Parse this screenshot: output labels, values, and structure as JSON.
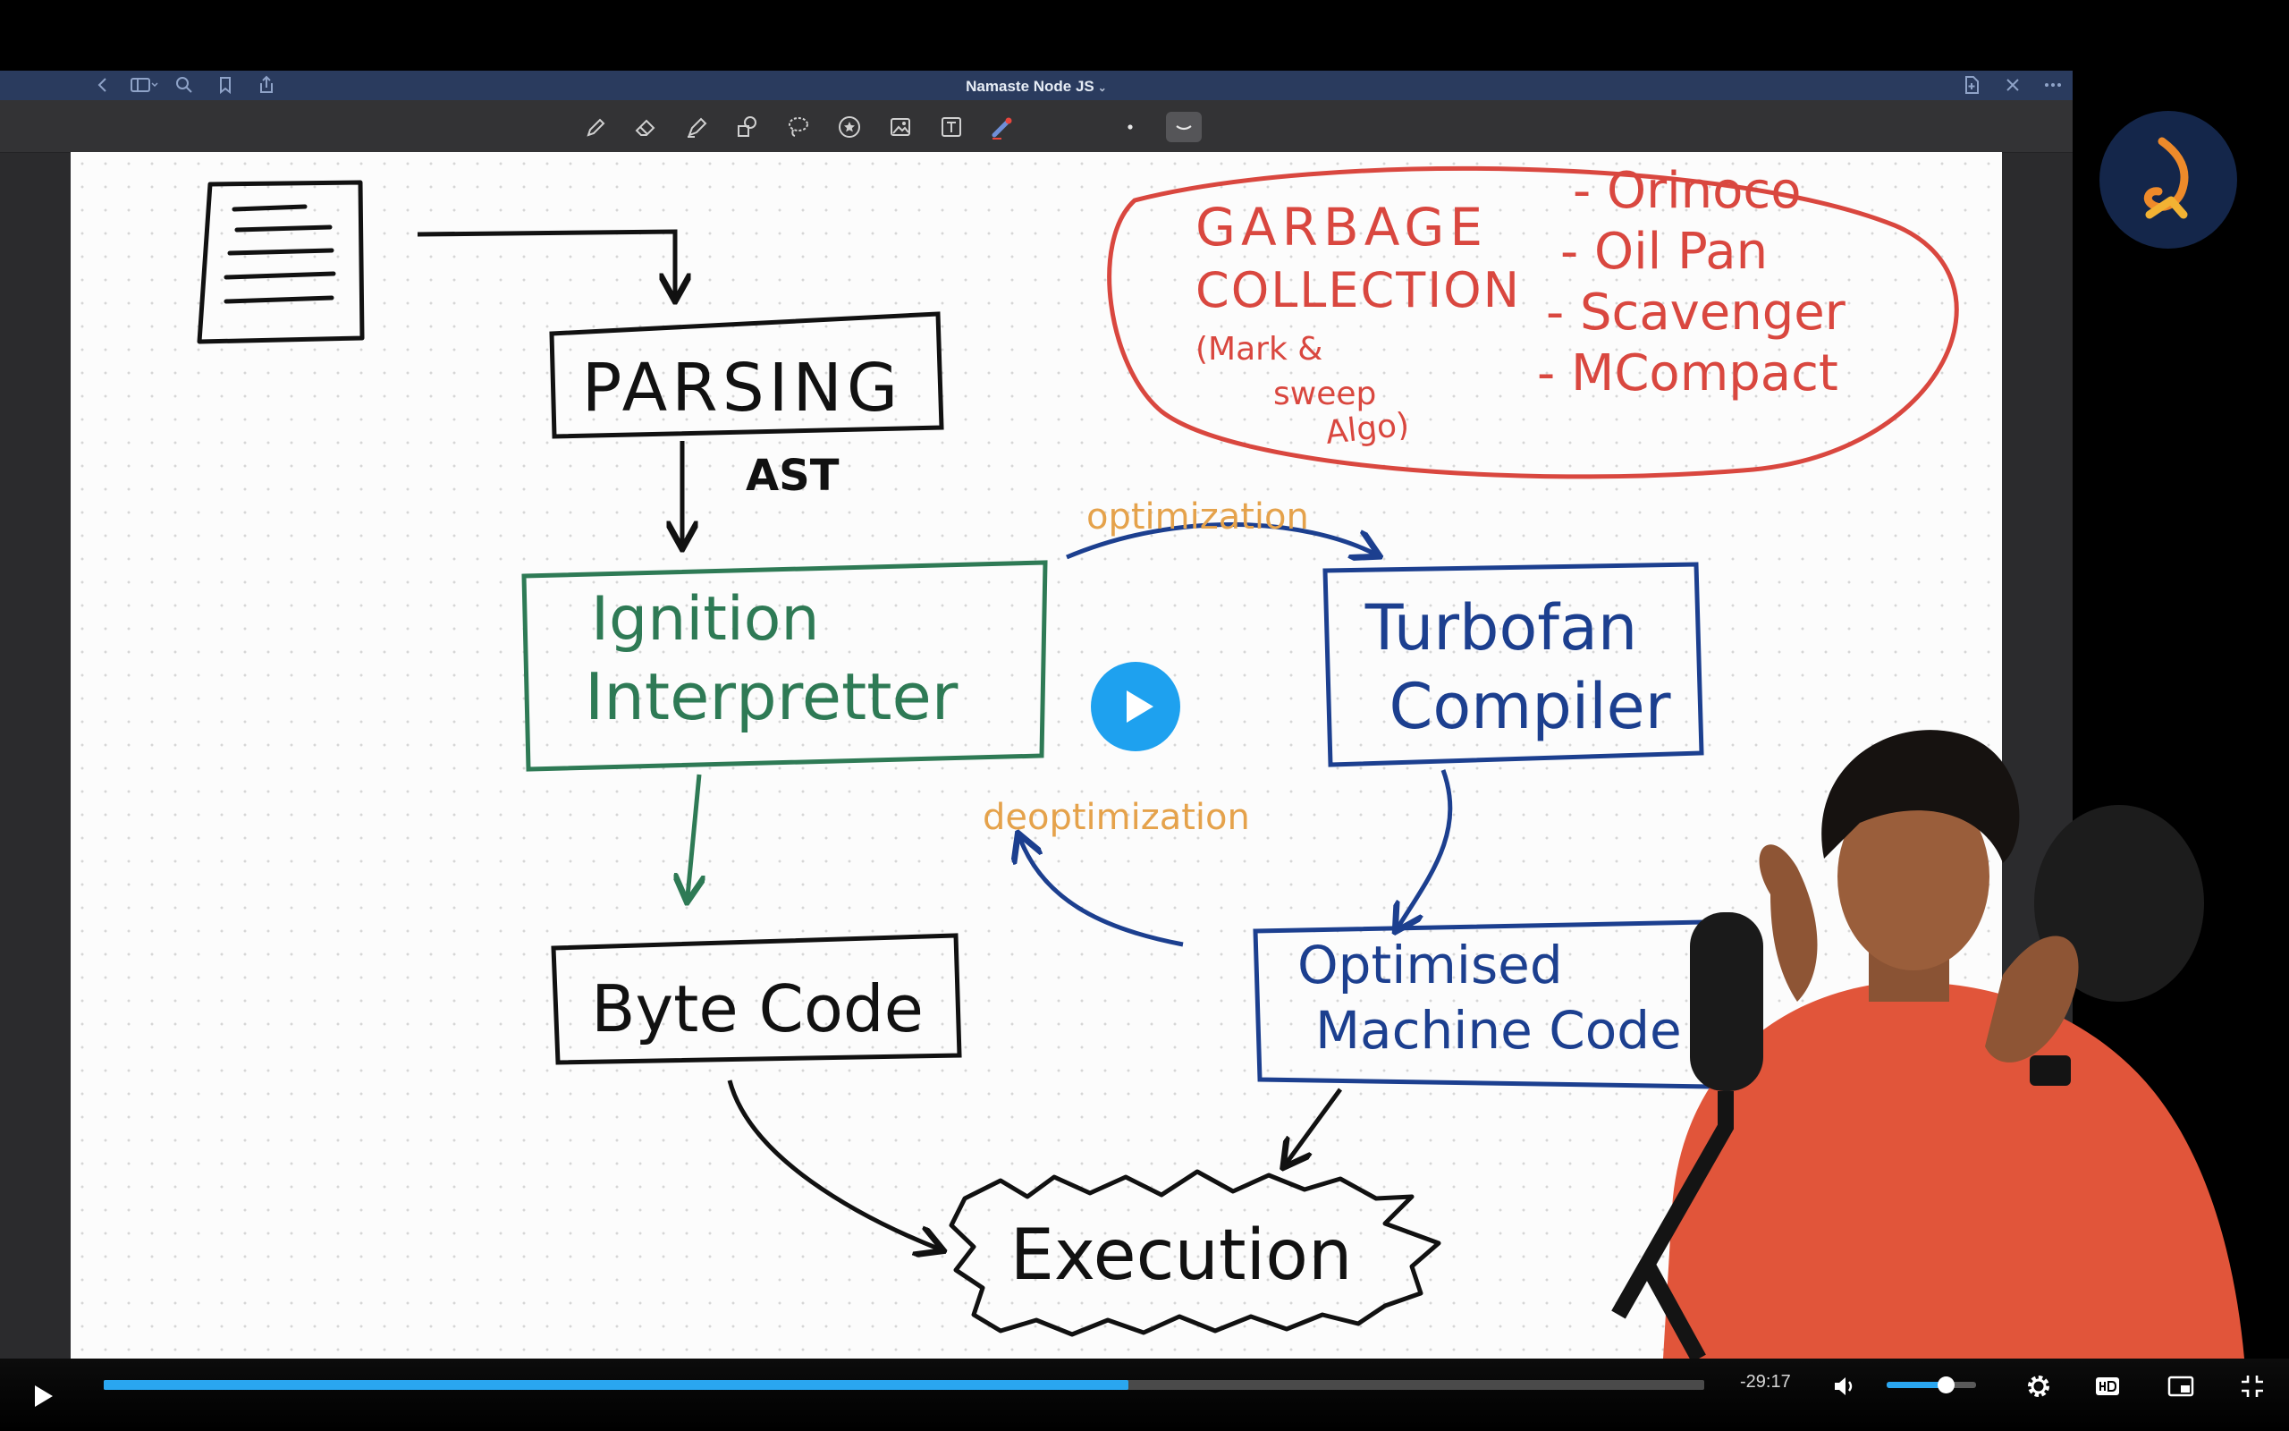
{
  "app": {
    "document_title": "Namaste Node JS",
    "title_chevron": "⌄"
  },
  "diagram": {
    "parsing": "PARSING",
    "ast": "AST",
    "ignition_line1": "Ignition",
    "ignition_line2": "Interpretter",
    "turbofan_line1": "Turbofan",
    "turbofan_line2": "Compiler",
    "optimization": "optimization",
    "deoptimization": "deoptimization",
    "byte_code": "Byte Code",
    "optimised_line1": "Optimised",
    "optimised_line2": "Machine Code",
    "execution": "Execution",
    "gc_line1": "GARBAGE",
    "gc_line2": "COLLECTION",
    "gc_note_line1": "(Mark &",
    "gc_note_line2": "sweep",
    "gc_note_line3": "Algo)",
    "gc_items": [
      "- Orinoco",
      "- Oil Pan",
      "- Scavenger",
      "- MCompact"
    ],
    "colors": {
      "ink": "#111111",
      "green": "#2e7a55",
      "blue": "#1c3f8f",
      "red": "#d9473f",
      "orange": "#e5a24b"
    }
  },
  "player": {
    "time_remaining": "-29:17",
    "progress_fraction": 0.64,
    "buffered_fraction": 0.64,
    "volume_fraction": 0.66,
    "accent": "#2aa6f0"
  }
}
